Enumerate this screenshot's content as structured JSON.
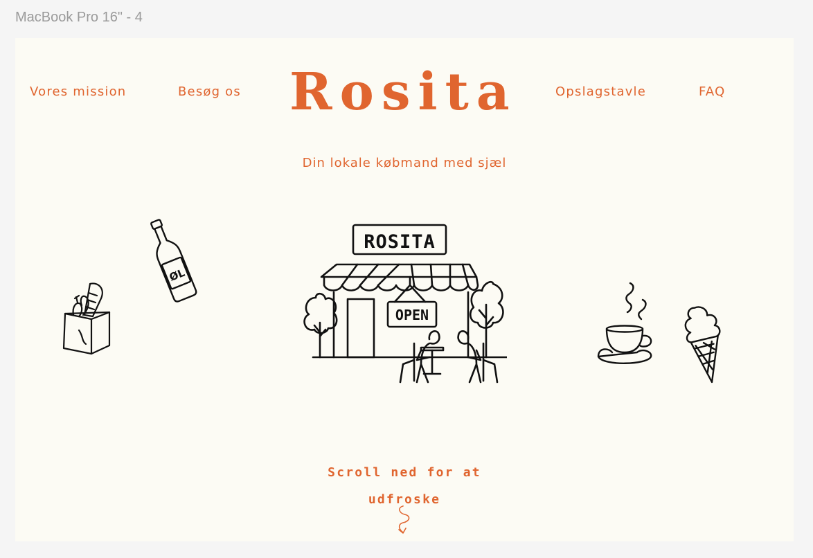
{
  "frame_title": "MacBook Pro 16\" - 4",
  "nav": {
    "mission": "Vores mission",
    "visit": "Besøg os",
    "board": "Opslagstavle",
    "faq": "FAQ"
  },
  "brand": "Rosita",
  "tagline": "Din lokale købmand med sjæl",
  "store_sign": "ROSITA",
  "open_sign": "OPEN",
  "bottle_label": "ØL",
  "scroll_line1": "Scroll ned for at",
  "scroll_line2": "udfroske",
  "colors": {
    "accent": "#e0652f",
    "background": "#fcfbf4",
    "ink": "#111111"
  },
  "icons": [
    "grocery-bag-icon",
    "beer-bottle-icon",
    "shop-front-illustration",
    "coffee-cup-icon",
    "ice-cream-icon",
    "squiggle-arrow-icon"
  ]
}
